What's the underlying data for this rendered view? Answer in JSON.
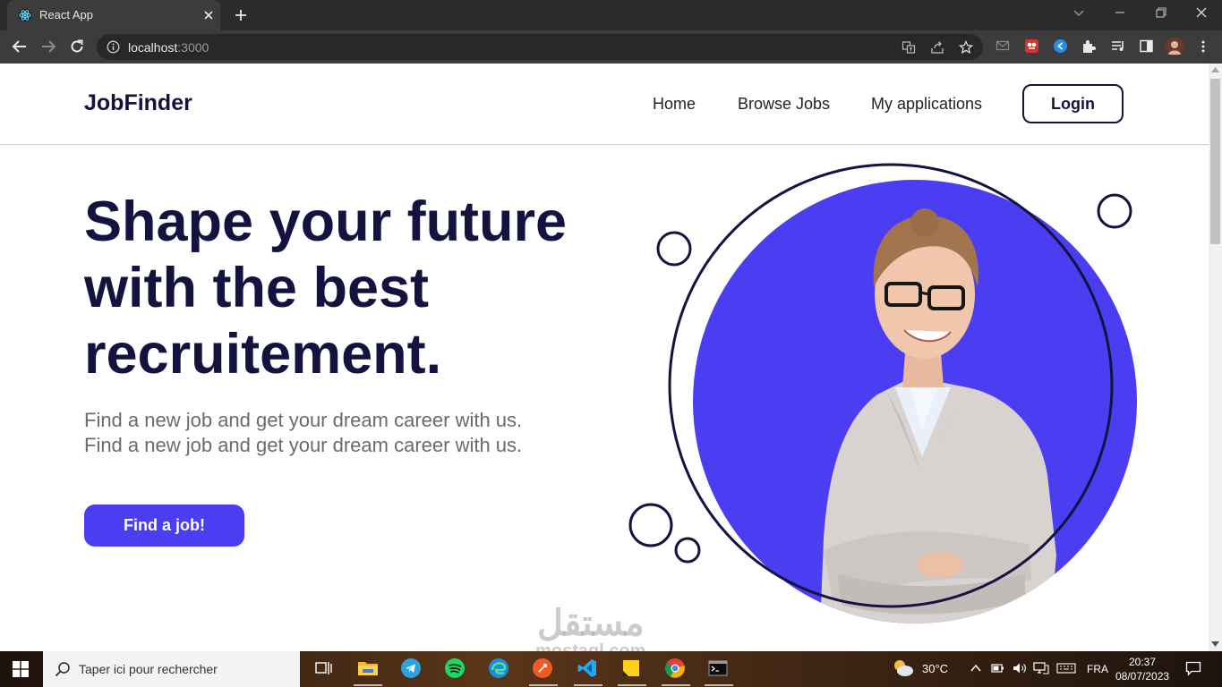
{
  "browser": {
    "tab_title": "React App",
    "url_host": "localhost",
    "url_port": ":3000"
  },
  "nav": {
    "logo": "JobFinder",
    "links": [
      "Home",
      "Browse Jobs",
      "My applications"
    ],
    "login_label": "Login"
  },
  "hero": {
    "title_lines": [
      "Shape your future",
      "with the best",
      "recruitement."
    ],
    "description": "Find a new job and get your dream career with us. Find a new job and get your dream career with us.",
    "cta_label": "Find a job!"
  },
  "colors": {
    "primary_dark": "#14123f",
    "accent_blue": "#4b3df2"
  },
  "watermark": {
    "arabic": "مستقل",
    "latin": "mostaql.com"
  },
  "taskbar": {
    "search_placeholder": "Taper ici pour rechercher",
    "weather": "30°C",
    "language": "FRA",
    "time": "20:37",
    "date": "08/07/2023",
    "apps": [
      "task-view-icon",
      "file-explorer-icon",
      "telegram-icon",
      "spotify-icon",
      "edge-icon",
      "postman-icon",
      "vscode-icon",
      "sticky-notes-icon",
      "chrome-icon",
      "terminal-icon"
    ]
  }
}
